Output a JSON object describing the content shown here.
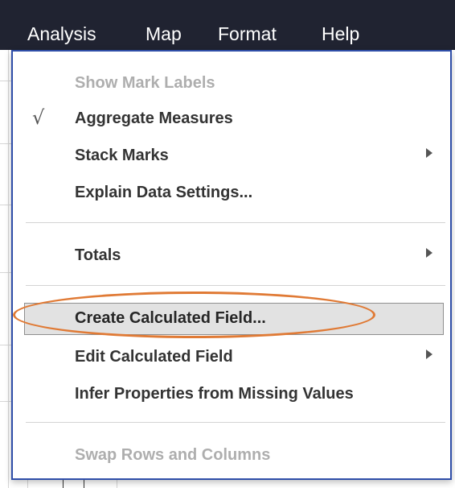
{
  "menubar": {
    "items": [
      {
        "label": "Analysis"
      },
      {
        "label": "Map"
      },
      {
        "label": "Format"
      },
      {
        "label": "Help"
      }
    ]
  },
  "analysis_menu": {
    "items": [
      {
        "label": "Show Mark Labels",
        "enabled": false,
        "checked": false,
        "has_submenu": false
      },
      {
        "label": "Aggregate Measures",
        "enabled": true,
        "checked": true,
        "check_glyph": "√",
        "has_submenu": false
      },
      {
        "label": "Stack Marks",
        "enabled": true,
        "checked": false,
        "has_submenu": true
      },
      {
        "label": "Explain Data Settings...",
        "enabled": true,
        "checked": false,
        "has_submenu": false
      },
      {
        "label": "Totals",
        "enabled": true,
        "checked": false,
        "has_submenu": true
      },
      {
        "label": "Create Calculated Field...",
        "enabled": true,
        "checked": false,
        "has_submenu": false,
        "highlighted": true
      },
      {
        "label": "Edit Calculated Field",
        "enabled": true,
        "checked": false,
        "has_submenu": true
      },
      {
        "label": "Infer Properties from Missing Values",
        "enabled": true,
        "checked": false,
        "has_submenu": false
      },
      {
        "label": "Swap Rows and Columns",
        "enabled": false,
        "checked": false,
        "has_submenu": false
      }
    ]
  },
  "annotation": {
    "color": "#e07a35",
    "target": "Create Calculated Field..."
  },
  "colors": {
    "menubar_bg": "#202331",
    "menu_border": "#2f4ea8",
    "highlight_bg": "#e2e2e2",
    "disabled_text": "#aeaeae"
  }
}
